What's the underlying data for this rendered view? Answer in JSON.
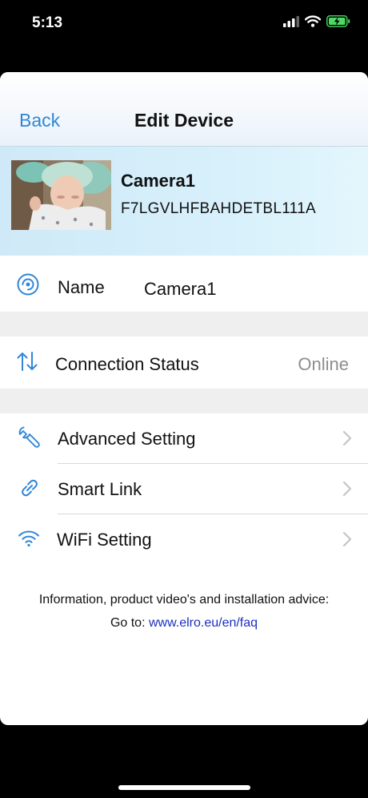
{
  "status_bar": {
    "time": "5:13"
  },
  "nav": {
    "back_label": "Back",
    "title": "Edit Device"
  },
  "device": {
    "name": "Camera1",
    "id": "F7LGVLHFBAHDETBL111A"
  },
  "rows": {
    "name": {
      "label": "Name",
      "value": "Camera1"
    },
    "connection": {
      "label": "Connection Status",
      "value": "Online"
    },
    "advanced": {
      "label": "Advanced Setting"
    },
    "smart_link": {
      "label": "Smart Link"
    },
    "wifi": {
      "label": "WiFi Setting"
    }
  },
  "info": {
    "line1": "Information, product video's and installation advice:",
    "goto_label": "Go to:",
    "link": "www.elro.eu/en/faq"
  },
  "colors": {
    "accent": "#2f86d8",
    "link": "#1a2fbf",
    "online": "#8e8e8e"
  },
  "icons": [
    "signal-icon",
    "wifi-icon",
    "battery-charging-icon",
    "target-icon",
    "arrows-updown-icon",
    "wrench-icon",
    "link-icon",
    "wifi-icon",
    "chevron-right-icon"
  ]
}
